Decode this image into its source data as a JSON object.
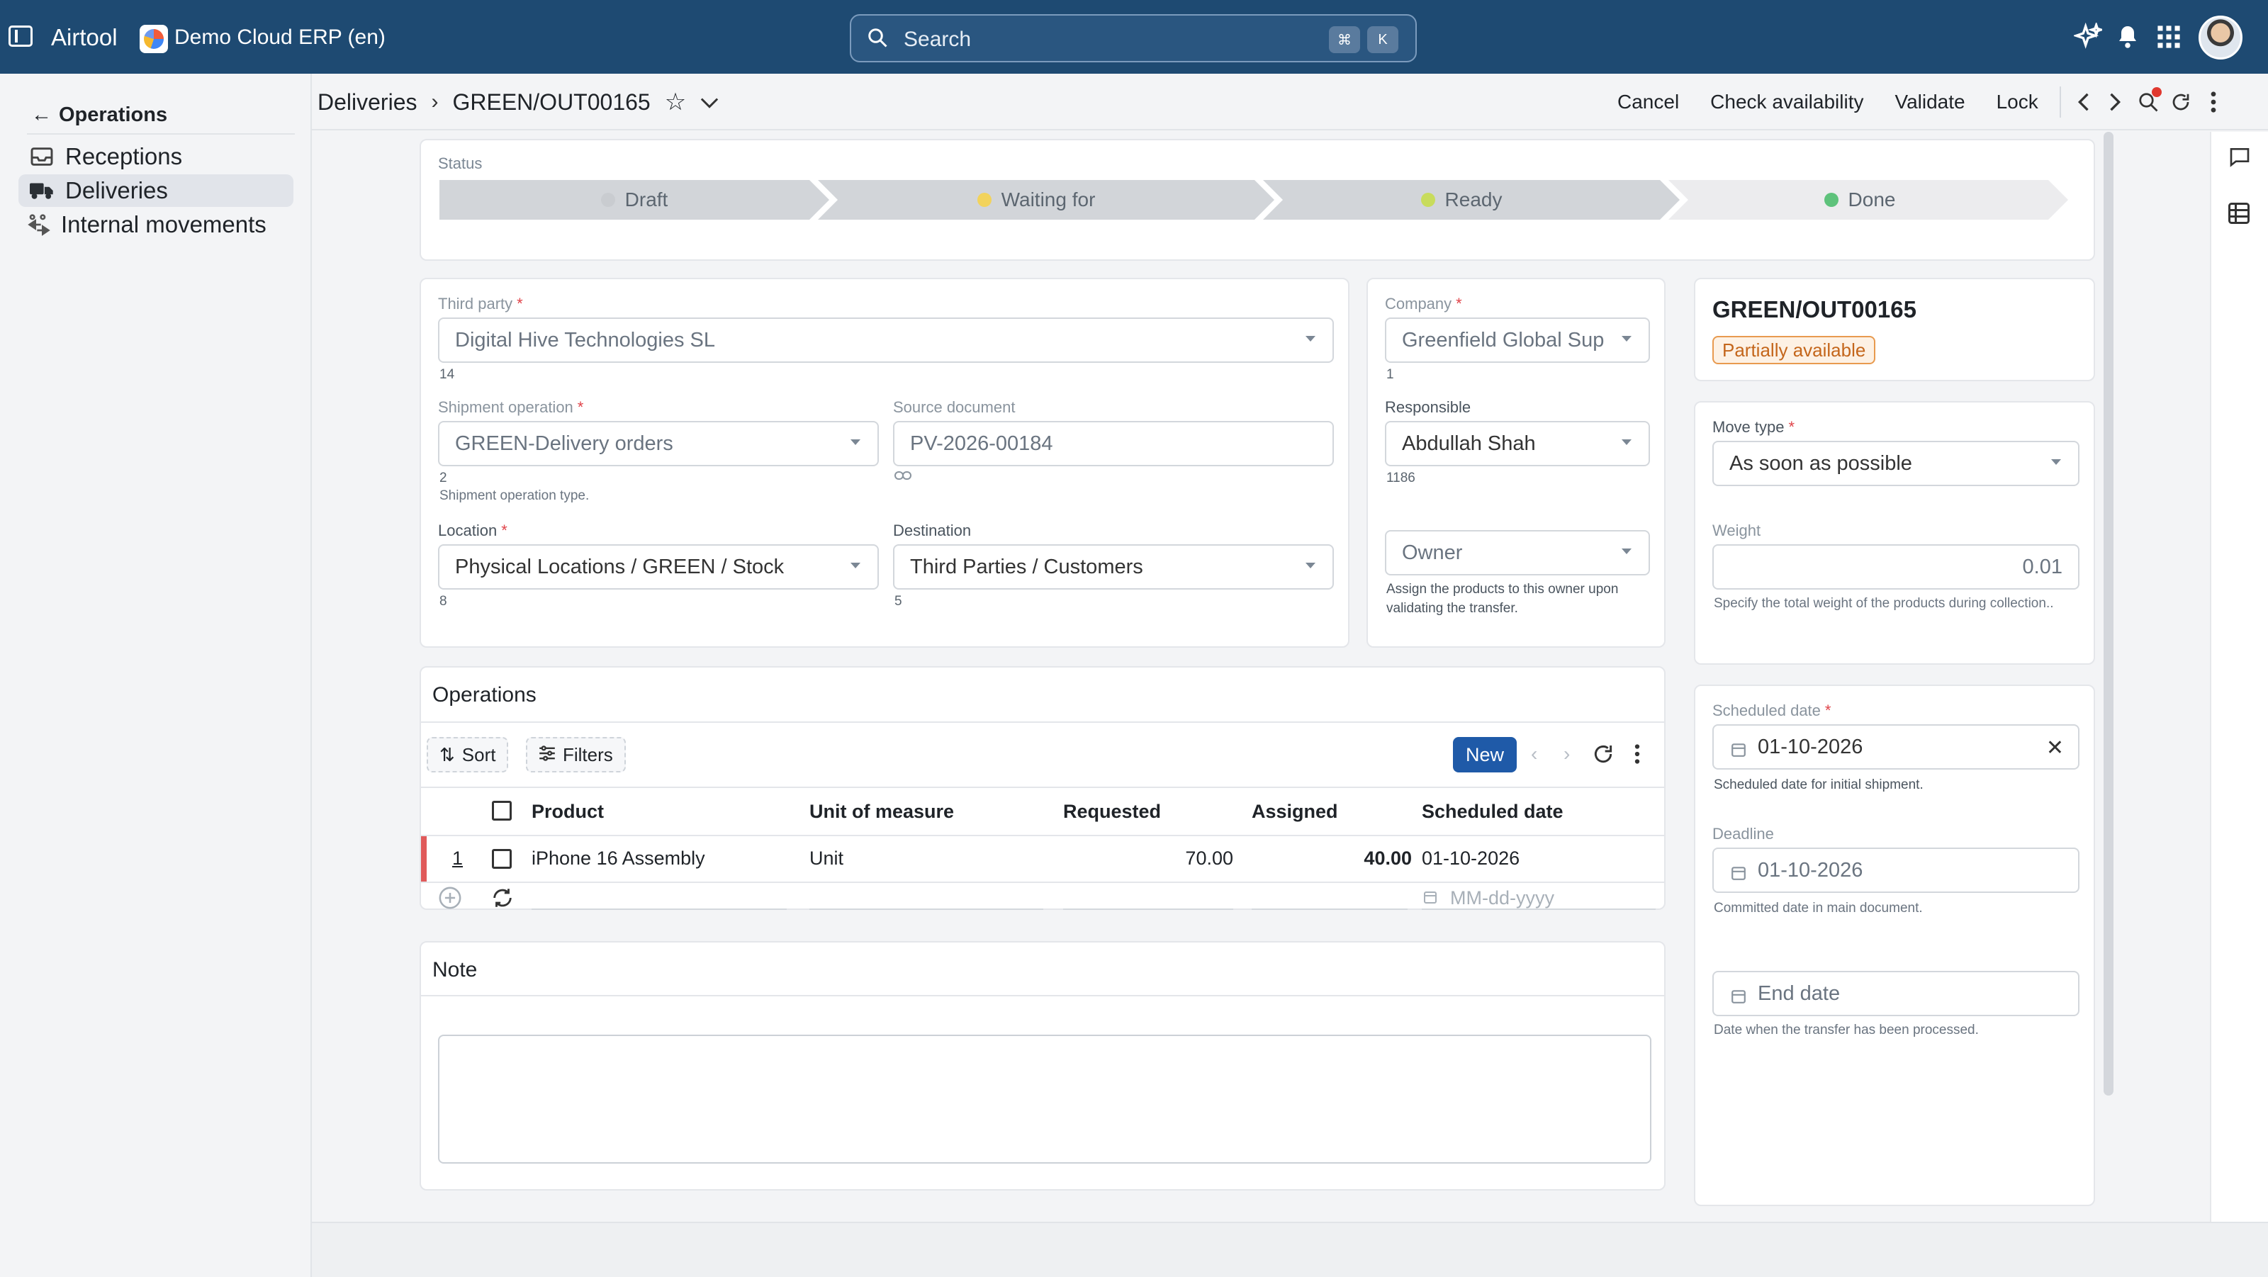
{
  "topbar": {
    "app_name": "Airtool",
    "company": "Demo Cloud ERP (en)",
    "search_placeholder": "Search",
    "shortcut_cmd": "⌘",
    "shortcut_key": "K"
  },
  "sidebar": {
    "back_label": "Operations",
    "items": [
      {
        "label": "Receptions",
        "icon": "inbox-icon"
      },
      {
        "label": "Deliveries",
        "icon": "truck-icon",
        "active": true
      },
      {
        "label": "Internal movements",
        "icon": "internal-move-icon"
      }
    ]
  },
  "header": {
    "breadcrumb_parent": "Deliveries",
    "breadcrumb_current": "GREEN/OUT00165",
    "actions": [
      "Cancel",
      "Check availability",
      "Validate",
      "Lock"
    ]
  },
  "status": {
    "label": "Status",
    "steps": [
      {
        "label": "Draft",
        "dot_color": "#d5d8dc"
      },
      {
        "label": "Waiting for",
        "dot_color": "#f2d35c"
      },
      {
        "label": "Ready",
        "dot_color": "#c8dc5c"
      },
      {
        "label": "Done",
        "dot_color": "#5ec27b"
      }
    ]
  },
  "form": {
    "third_party": {
      "label": "Third party",
      "value": "Digital Hive Technologies SL",
      "sub": "14"
    },
    "shipment_operation": {
      "label": "Shipment operation",
      "value": "GREEN-Delivery orders",
      "sub": "2",
      "hint": "Shipment operation type."
    },
    "source_document": {
      "label": "Source document",
      "value": "PV-2026-00184"
    },
    "location": {
      "label": "Location",
      "value": "Physical Locations / GREEN / Stock",
      "sub": "8"
    },
    "destination": {
      "label": "Destination",
      "value": "Third Parties / Customers",
      "sub": "5"
    },
    "company": {
      "label": "Company",
      "value": "Greenfield Global Sup",
      "sub": "1"
    },
    "responsible": {
      "label": "Responsible",
      "value": "Abdullah Shah",
      "sub": "1186"
    },
    "owner": {
      "placeholder": "Owner",
      "hint": "Assign the products to this owner upon validating the transfer."
    }
  },
  "summary": {
    "title": "GREEN/OUT00165",
    "badge": "Partially available"
  },
  "move": {
    "move_type": {
      "label": "Move type",
      "value": "As soon as possible"
    },
    "weight": {
      "label": "Weight",
      "value": "0.01",
      "hint": "Specify the total weight of the products during collection.."
    }
  },
  "dates": {
    "scheduled": {
      "label": "Scheduled date",
      "value": "01-10-2026",
      "hint": "Scheduled date for initial shipment."
    },
    "deadline": {
      "label": "Deadline",
      "value": "01-10-2026",
      "hint": "Committed date in main document."
    },
    "end": {
      "placeholder": "End date",
      "hint": "Date when the transfer has been processed."
    }
  },
  "operations": {
    "title": "Operations",
    "sort_label": "Sort",
    "filters_label": "Filters",
    "new_label": "New",
    "columns": [
      "Product",
      "Unit of measure",
      "Requested",
      "Assigned",
      "Scheduled date"
    ],
    "rows": [
      {
        "num": "1",
        "product": "iPhone 16 Assembly",
        "uom": "Unit",
        "requested": "70.00",
        "assigned": "40.00",
        "scheduled": "01-10-2026"
      }
    ],
    "new_row_date_placeholder": "MM-dd-yyyy"
  },
  "note": {
    "title": "Note"
  }
}
